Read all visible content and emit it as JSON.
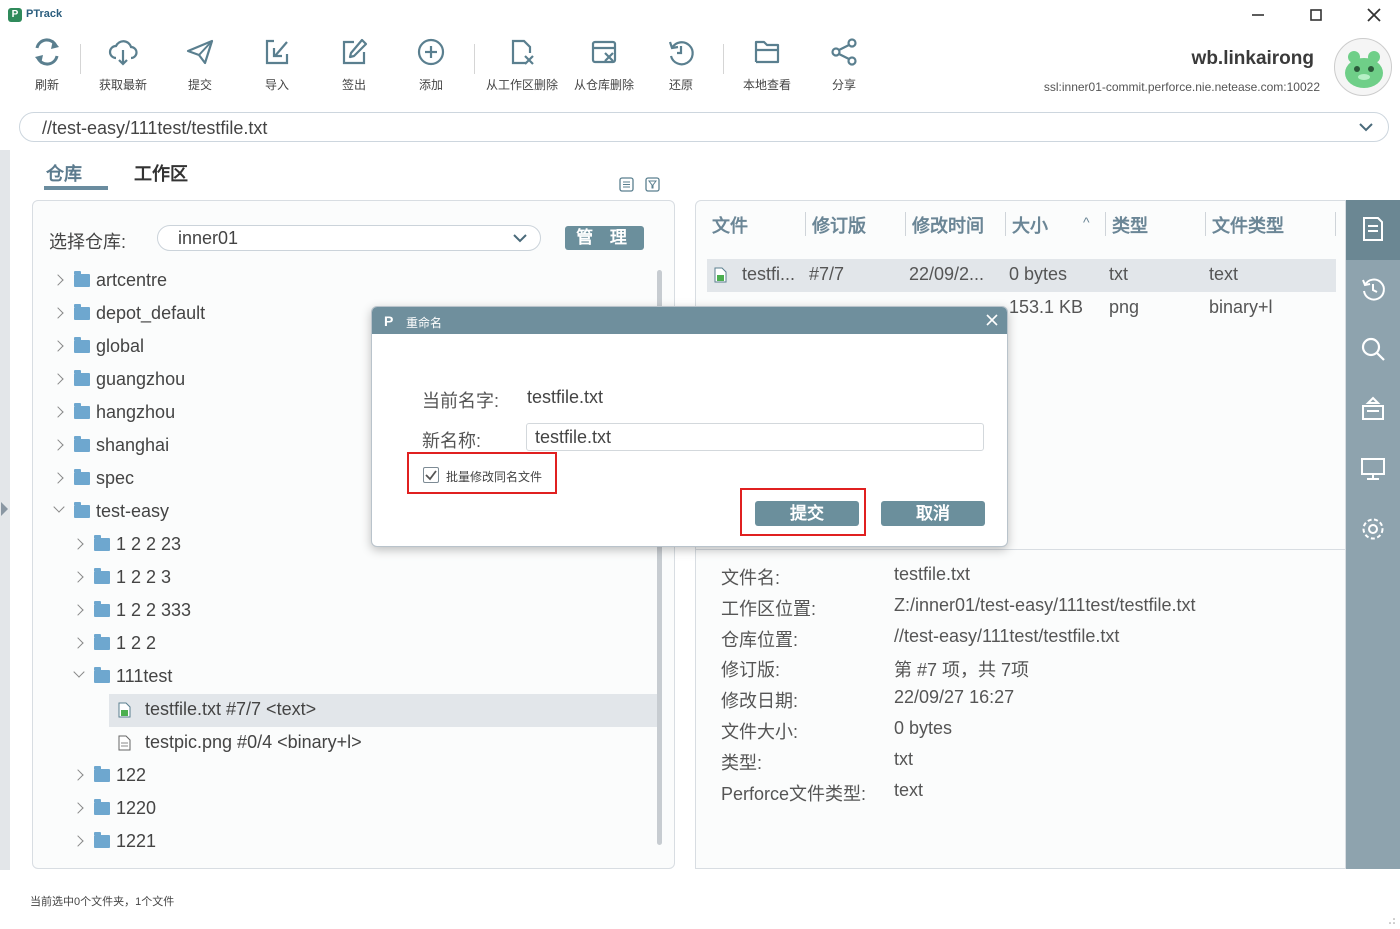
{
  "app": {
    "title": "PTrack",
    "logo": "P"
  },
  "window_controls": {
    "minimize_icon": "minimize-icon",
    "maximize_icon": "maximize-icon",
    "close_icon": "close-icon"
  },
  "toolbar": {
    "items": [
      {
        "label": "刷新",
        "icon": "refresh-icon"
      },
      {
        "label": "获取最新",
        "icon": "cloud-download-icon"
      },
      {
        "label": "提交",
        "icon": "send-icon"
      },
      {
        "label": "导入",
        "icon": "import-icon"
      },
      {
        "label": "签出",
        "icon": "edit-icon"
      },
      {
        "label": "添加",
        "icon": "add-circle-icon"
      },
      {
        "label": "从工作区删除",
        "icon": "file-delete-icon"
      },
      {
        "label": "从仓库删除",
        "icon": "repo-delete-icon"
      },
      {
        "label": "还原",
        "icon": "revert-icon"
      },
      {
        "label": "本地查看",
        "icon": "folder-open-icon"
      },
      {
        "label": "分享",
        "icon": "share-icon"
      }
    ]
  },
  "user": {
    "name": "wb.linkairong",
    "server": "ssl:inner01-commit.perforce.nie.netease.com:10022"
  },
  "path_bar": {
    "value": "//test-easy/111test/testfile.txt"
  },
  "tabs": {
    "repo": "仓库",
    "workspace": "工作区"
  },
  "repo_selector": {
    "label": "选择仓库:",
    "value": "inner01",
    "manage_label": "管 理"
  },
  "tree": {
    "items": [
      {
        "label": "artcentre"
      },
      {
        "label": "depot_default"
      },
      {
        "label": "global"
      },
      {
        "label": "guangzhou"
      },
      {
        "label": "hangzhou"
      },
      {
        "label": "shanghai"
      },
      {
        "label": "spec"
      },
      {
        "label": "test-easy"
      },
      {
        "label": "1 2 2 23"
      },
      {
        "label": "1 2 2 3"
      },
      {
        "label": "1 2 2 333"
      },
      {
        "label": "1 2 2"
      },
      {
        "label": "111test"
      },
      {
        "label": "testfile.txt  #7/7 <text>"
      },
      {
        "label": "testpic.png  #0/4 <binary+l>"
      },
      {
        "label": "122"
      },
      {
        "label": "1220"
      },
      {
        "label": "1221"
      }
    ]
  },
  "file_table": {
    "headers": [
      "文件",
      "修订版",
      "修改时间",
      "大小",
      "类型",
      "文件类型"
    ],
    "sort_indicator": "^",
    "rows": [
      [
        "testfi...",
        "#7/7",
        "22/09/2...",
        "0 bytes",
        "txt",
        "text"
      ],
      [
        "",
        "",
        "",
        "153.1 KB",
        "png",
        "binary+l"
      ]
    ]
  },
  "details": {
    "labels": [
      "文件名:",
      "工作区位置:",
      "仓库位置:",
      "修订版:",
      "修改日期:",
      "文件大小:",
      "类型:",
      "Perforce文件类型:"
    ],
    "values": [
      "testfile.txt",
      "Z:/inner01/test-easy/111test/testfile.txt",
      "//test-easy/111test/testfile.txt",
      "第 #7 项，共 7项",
      "22/09/27 16:27",
      "0 bytes",
      "txt",
      "text"
    ]
  },
  "sidebar": {
    "icons": [
      "document-icon",
      "history-icon",
      "search-icon",
      "stack-icon",
      "monitor-icon",
      "settings-icon"
    ]
  },
  "status": {
    "text": "当前选中0个文件夹，1个文件"
  },
  "dialog": {
    "title": "重命名",
    "current_label": "当前名字:",
    "current_value": "testfile.txt",
    "new_label": "新名称:",
    "new_value": "testfile.txt",
    "batch_label": "批量修改同名文件",
    "batch_checked": true,
    "submit_label": "提交",
    "cancel_label": "取消",
    "highlight_color": "#e02020"
  },
  "colors": {
    "accent": "#6b8f9c",
    "sidebar": "#8ea3ae",
    "selection": "#e2e6ea"
  }
}
